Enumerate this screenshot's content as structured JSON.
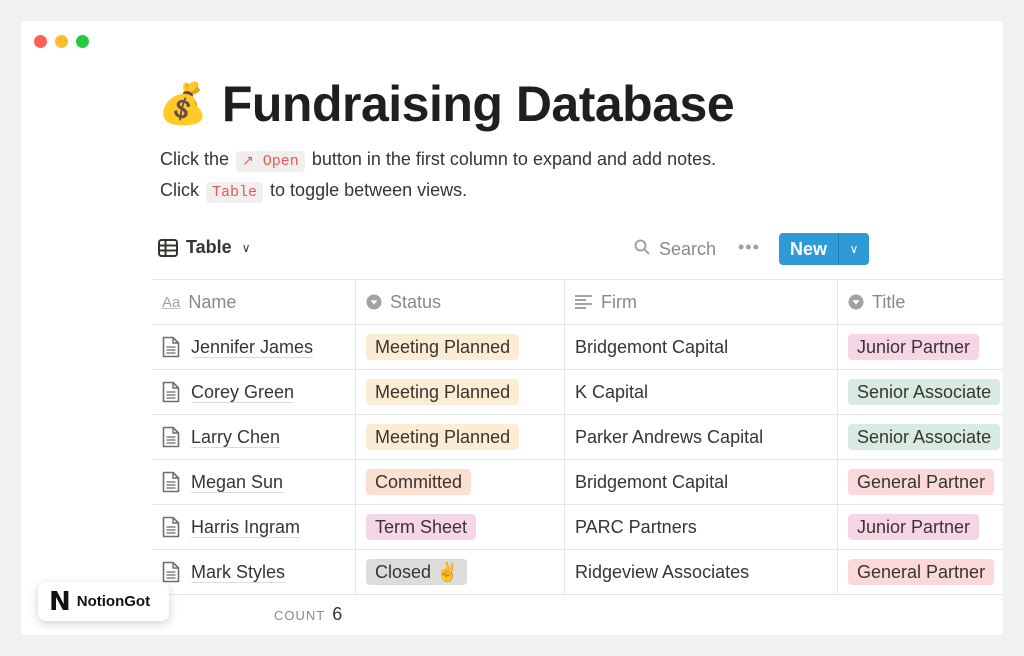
{
  "window": {
    "traffic_lights": [
      "close",
      "minimize",
      "maximize"
    ]
  },
  "page": {
    "emoji": "💰",
    "title": "Fundraising Database",
    "description": {
      "line1_before": "Click the",
      "line1_code_icon": "↗",
      "line1_code": "Open",
      "line1_after": "button in the first column to expand and add notes.",
      "line2_before": "Click",
      "line2_code": "Table",
      "line2_after": "to toggle between views."
    }
  },
  "toolbar": {
    "view_label": "Table",
    "view_icon": "table-icon",
    "search_label": "Search",
    "more_label": "•••",
    "new_label": "New",
    "new_dropdown_icon": "chevron-down-icon"
  },
  "table": {
    "columns": [
      {
        "label": "Name",
        "icon": "Aa"
      },
      {
        "label": "Status",
        "icon": "select-icon"
      },
      {
        "label": "Firm",
        "icon": "text-icon"
      },
      {
        "label": "Title",
        "icon": "select-icon"
      }
    ],
    "rows": [
      {
        "name": "Jennifer James",
        "status": "Meeting Planned",
        "status_color": "#fbecd4",
        "firm": "Bridgemont Capital",
        "title": "Junior Partner",
        "title_color": "#f6d6e6"
      },
      {
        "name": "Corey Green",
        "status": "Meeting Planned",
        "status_color": "#fbecd4",
        "firm": "K Capital",
        "title": "Senior Associate",
        "title_color": "#d8ebe3"
      },
      {
        "name": "Larry Chen",
        "status": "Meeting Planned",
        "status_color": "#fbecd4",
        "firm": "Parker Andrews Capital",
        "title": "Senior Associate",
        "title_color": "#d8ebe3"
      },
      {
        "name": "Megan Sun",
        "status": "Committed",
        "status_color": "#fbe0d2",
        "firm": "Bridgemont Capital",
        "title": "General Partner",
        "title_color": "#fbd9da"
      },
      {
        "name": "Harris Ingram",
        "status": "Term Sheet",
        "status_color": "#f6d6e6",
        "firm": "PARC Partners",
        "title": "Junior Partner",
        "title_color": "#f6d6e6"
      },
      {
        "name": "Mark Styles",
        "status": "Closed ✌️",
        "status_color": "#dcdcdc",
        "firm": "Ridgeview Associates",
        "title": "General Partner",
        "title_color": "#fbd9da"
      }
    ]
  },
  "footer": {
    "count_label": "COUNT",
    "count_value": "6"
  },
  "brand": {
    "logo": "N",
    "name": "NotionGot"
  },
  "colors": {
    "accent": "#2e9bd6",
    "code_text": "#eb5757"
  }
}
